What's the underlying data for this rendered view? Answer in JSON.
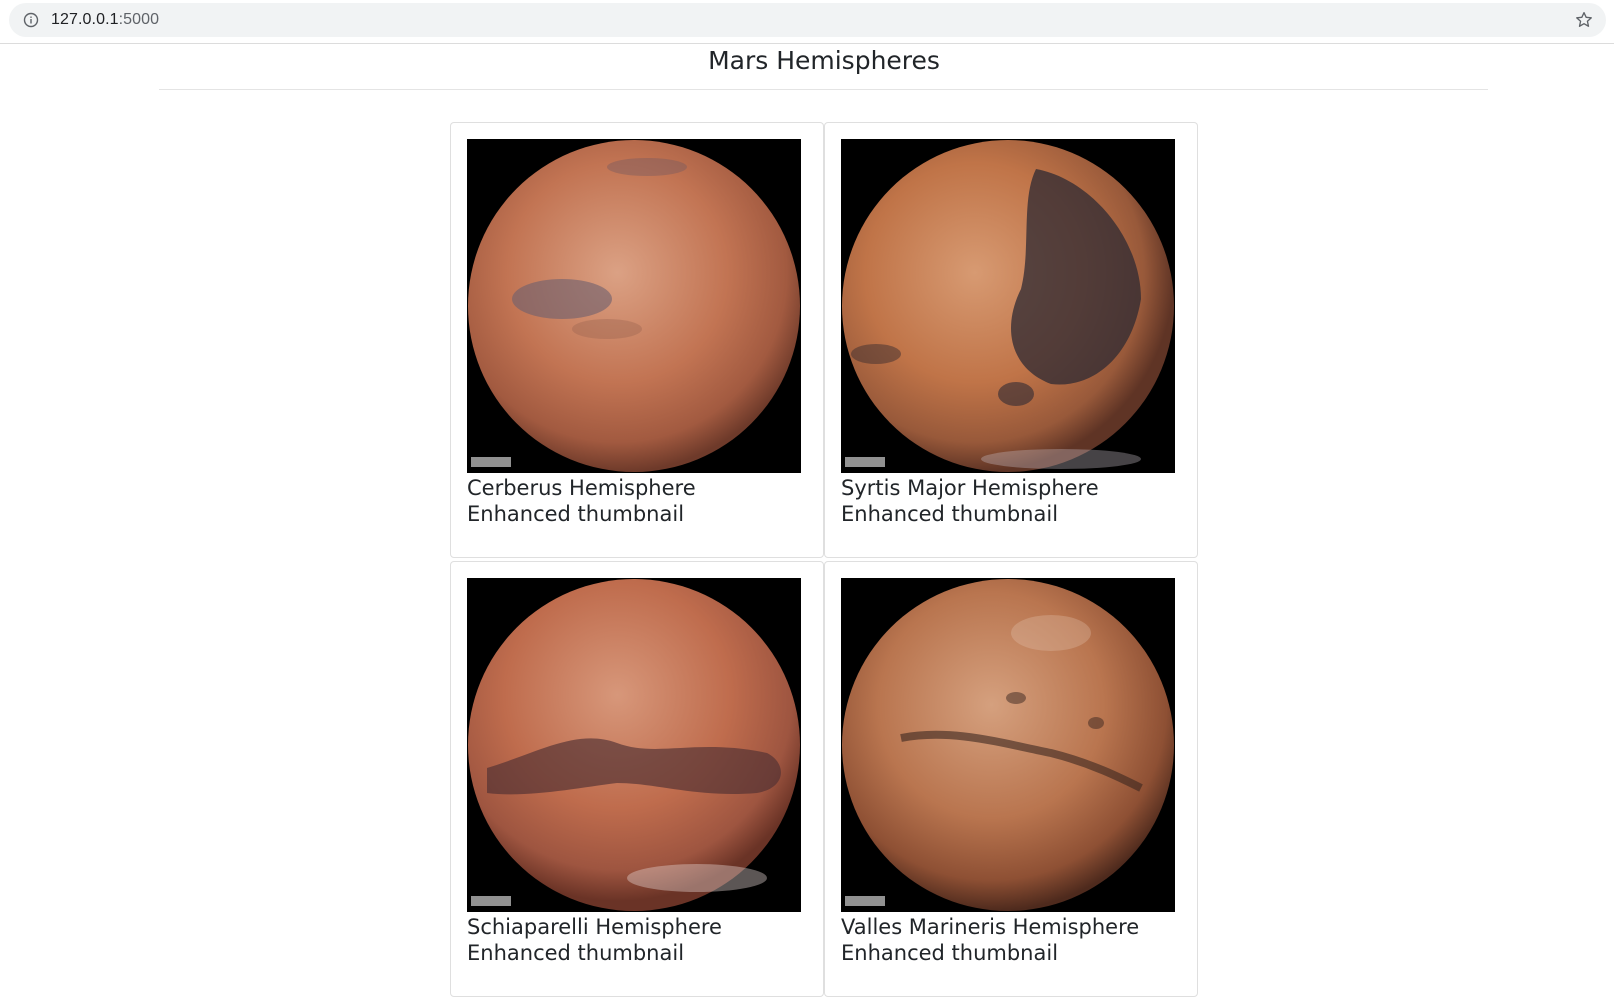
{
  "browser": {
    "url_host": "127.0.0.1",
    "url_port": ":5000"
  },
  "page": {
    "title": "Mars Hemispheres"
  },
  "hemispheres": [
    {
      "caption": "Cerberus Hemisphere Enhanced thumbnail",
      "image_icon": "mars-cerberus-image"
    },
    {
      "caption": "Syrtis Major Hemisphere Enhanced thumbnail",
      "image_icon": "mars-syrtis-major-image"
    },
    {
      "caption": "Schiaparelli Hemisphere Enhanced thumbnail",
      "image_icon": "mars-schiaparelli-image"
    },
    {
      "caption": "Valles Marineris Hemisphere Enhanced thumbnail",
      "image_icon": "mars-valles-marineris-image"
    }
  ],
  "colors": {
    "mars_base": "#c06a45",
    "mars_light": "#d99a78",
    "mars_dark": "#5a3a38",
    "background": "#000000"
  }
}
